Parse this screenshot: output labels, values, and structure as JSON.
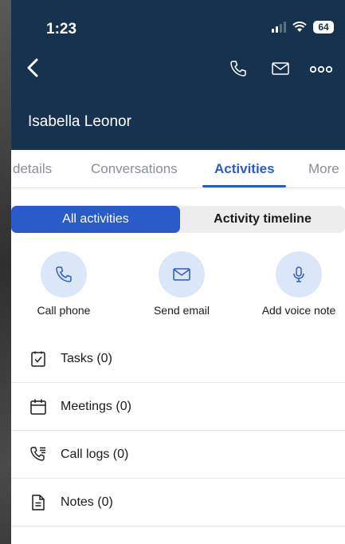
{
  "status_bar": {
    "time": "1:23",
    "battery": "64"
  },
  "header": {
    "contact_name": "Isabella Leonor",
    "back_icon": "chevron-left-icon",
    "actions": [
      "phone-icon",
      "mail-icon",
      "more-icon"
    ]
  },
  "tabs": [
    {
      "label": "details",
      "active": false
    },
    {
      "label": "Conversations",
      "active": false
    },
    {
      "label": "Activities",
      "active": true
    },
    {
      "label": "More",
      "active": false
    }
  ],
  "segmented": {
    "active_label": "All activities",
    "inactive_label": "Activity timeline"
  },
  "quick_actions": [
    {
      "label": "Call phone",
      "icon": "phone-icon"
    },
    {
      "label": "Send email",
      "icon": "mail-icon"
    },
    {
      "label": "Add voice note",
      "icon": "microphone-icon"
    }
  ],
  "activity_list": [
    {
      "label": "Tasks (0)",
      "icon": "task-checklist-icon"
    },
    {
      "label": "Meetings (0)",
      "icon": "calendar-icon"
    },
    {
      "label": "Call logs (0)",
      "icon": "call-log-icon"
    },
    {
      "label": "Notes (0)",
      "icon": "note-icon"
    }
  ],
  "colors": {
    "header_bg": "#16324f",
    "accent": "#2a5bc8",
    "icon_circle_bg": "#dbe7f8"
  }
}
